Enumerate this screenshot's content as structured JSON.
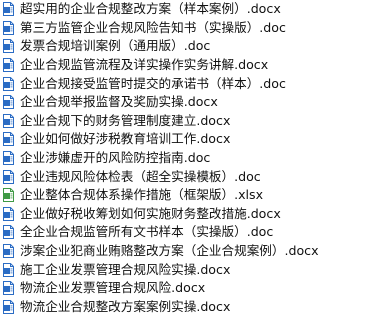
{
  "colors": {
    "doc_icon": "#2b6cc4",
    "xlsx_icon": "#3f9a45",
    "text": "#111111",
    "background": "#ffffff"
  },
  "files": [
    {
      "name": "超实用的企业合规整改方案（样本案例）.docx",
      "icon": "word-doc-icon"
    },
    {
      "name": "第三方监管企业合规风险告知书（实操版）.doc",
      "icon": "word-doc-icon"
    },
    {
      "name": "发票合规培训案例（通用版）.doc",
      "icon": "word-doc-icon"
    },
    {
      "name": "企业合规监管流程及详实操作实务讲解.docx",
      "icon": "word-doc-icon"
    },
    {
      "name": "企业合规接受监管时提交的承诺书（样本）.doc",
      "icon": "word-doc-icon"
    },
    {
      "name": "企业合规举报监督及奖励实操.docx",
      "icon": "word-doc-icon"
    },
    {
      "name": "企业合规下的财务管理制度建立.docx",
      "icon": "word-doc-icon"
    },
    {
      "name": "企业如何做好涉税教育培训工作.docx",
      "icon": "word-doc-icon"
    },
    {
      "name": "企业涉嫌虚开的风险防控指南.doc",
      "icon": "word-doc-icon"
    },
    {
      "name": "企业违规风险体检表（超全实操模板）.doc",
      "icon": "word-doc-icon"
    },
    {
      "name": "企业整体合规体系操作措施（框架版）.xlsx",
      "icon": "excel-xlsx-icon"
    },
    {
      "name": "企业做好税收筹划如何实施财务整改措施.docx",
      "icon": "word-doc-icon"
    },
    {
      "name": "全企业合规监管所有文书样本（实操版）.doc",
      "icon": "word-doc-icon"
    },
    {
      "name": "涉案企业犯商业贿赂整改方案（企业合规案例）.docx",
      "icon": "word-doc-icon"
    },
    {
      "name": "施工企业发票管理合规风险实操.docx",
      "icon": "word-doc-icon"
    },
    {
      "name": "物流企业发票管理合规风险.docx",
      "icon": "word-doc-icon"
    },
    {
      "name": "物流企业合规整改方案案例实操.docx",
      "icon": "word-doc-icon"
    }
  ]
}
